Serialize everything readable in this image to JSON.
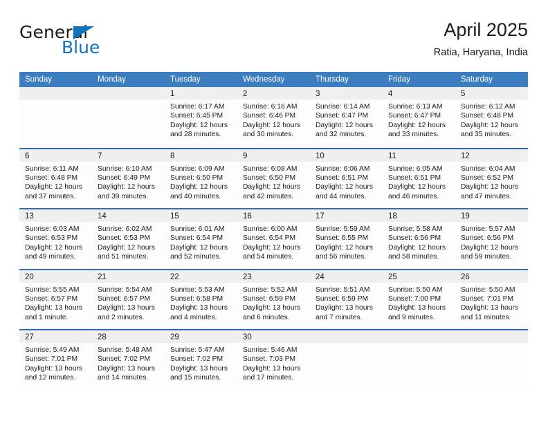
{
  "brand": {
    "name_part1": "General",
    "name_part2": "Blue",
    "triangle_color": "#1273bd"
  },
  "header": {
    "title": "April 2025",
    "subtitle": "Ratia, Haryana, India"
  },
  "calendar": {
    "header_bg": "#3b7dbf",
    "row_divider_color": "#2f6fab",
    "day_band_bg": "#efefef",
    "weekdays": [
      "Sunday",
      "Monday",
      "Tuesday",
      "Wednesday",
      "Thursday",
      "Friday",
      "Saturday"
    ],
    "weeks": [
      [
        {
          "day": "",
          "empty": true
        },
        {
          "day": "",
          "empty": true
        },
        {
          "day": "1",
          "sunrise": "Sunrise: 6:17 AM",
          "sunset": "Sunset: 6:45 PM",
          "daylight_line1": "Daylight: 12 hours",
          "daylight_line2": "and 28 minutes."
        },
        {
          "day": "2",
          "sunrise": "Sunrise: 6:16 AM",
          "sunset": "Sunset: 6:46 PM",
          "daylight_line1": "Daylight: 12 hours",
          "daylight_line2": "and 30 minutes."
        },
        {
          "day": "3",
          "sunrise": "Sunrise: 6:14 AM",
          "sunset": "Sunset: 6:47 PM",
          "daylight_line1": "Daylight: 12 hours",
          "daylight_line2": "and 32 minutes."
        },
        {
          "day": "4",
          "sunrise": "Sunrise: 6:13 AM",
          "sunset": "Sunset: 6:47 PM",
          "daylight_line1": "Daylight: 12 hours",
          "daylight_line2": "and 33 minutes."
        },
        {
          "day": "5",
          "sunrise": "Sunrise: 6:12 AM",
          "sunset": "Sunset: 6:48 PM",
          "daylight_line1": "Daylight: 12 hours",
          "daylight_line2": "and 35 minutes."
        }
      ],
      [
        {
          "day": "6",
          "sunrise": "Sunrise: 6:11 AM",
          "sunset": "Sunset: 6:48 PM",
          "daylight_line1": "Daylight: 12 hours",
          "daylight_line2": "and 37 minutes."
        },
        {
          "day": "7",
          "sunrise": "Sunrise: 6:10 AM",
          "sunset": "Sunset: 6:49 PM",
          "daylight_line1": "Daylight: 12 hours",
          "daylight_line2": "and 39 minutes."
        },
        {
          "day": "8",
          "sunrise": "Sunrise: 6:09 AM",
          "sunset": "Sunset: 6:50 PM",
          "daylight_line1": "Daylight: 12 hours",
          "daylight_line2": "and 40 minutes."
        },
        {
          "day": "9",
          "sunrise": "Sunrise: 6:08 AM",
          "sunset": "Sunset: 6:50 PM",
          "daylight_line1": "Daylight: 12 hours",
          "daylight_line2": "and 42 minutes."
        },
        {
          "day": "10",
          "sunrise": "Sunrise: 6:06 AM",
          "sunset": "Sunset: 6:51 PM",
          "daylight_line1": "Daylight: 12 hours",
          "daylight_line2": "and 44 minutes."
        },
        {
          "day": "11",
          "sunrise": "Sunrise: 6:05 AM",
          "sunset": "Sunset: 6:51 PM",
          "daylight_line1": "Daylight: 12 hours",
          "daylight_line2": "and 46 minutes."
        },
        {
          "day": "12",
          "sunrise": "Sunrise: 6:04 AM",
          "sunset": "Sunset: 6:52 PM",
          "daylight_line1": "Daylight: 12 hours",
          "daylight_line2": "and 47 minutes."
        }
      ],
      [
        {
          "day": "13",
          "sunrise": "Sunrise: 6:03 AM",
          "sunset": "Sunset: 6:53 PM",
          "daylight_line1": "Daylight: 12 hours",
          "daylight_line2": "and 49 minutes."
        },
        {
          "day": "14",
          "sunrise": "Sunrise: 6:02 AM",
          "sunset": "Sunset: 6:53 PM",
          "daylight_line1": "Daylight: 12 hours",
          "daylight_line2": "and 51 minutes."
        },
        {
          "day": "15",
          "sunrise": "Sunrise: 6:01 AM",
          "sunset": "Sunset: 6:54 PM",
          "daylight_line1": "Daylight: 12 hours",
          "daylight_line2": "and 52 minutes."
        },
        {
          "day": "16",
          "sunrise": "Sunrise: 6:00 AM",
          "sunset": "Sunset: 6:54 PM",
          "daylight_line1": "Daylight: 12 hours",
          "daylight_line2": "and 54 minutes."
        },
        {
          "day": "17",
          "sunrise": "Sunrise: 5:59 AM",
          "sunset": "Sunset: 6:55 PM",
          "daylight_line1": "Daylight: 12 hours",
          "daylight_line2": "and 56 minutes."
        },
        {
          "day": "18",
          "sunrise": "Sunrise: 5:58 AM",
          "sunset": "Sunset: 6:56 PM",
          "daylight_line1": "Daylight: 12 hours",
          "daylight_line2": "and 58 minutes."
        },
        {
          "day": "19",
          "sunrise": "Sunrise: 5:57 AM",
          "sunset": "Sunset: 6:56 PM",
          "daylight_line1": "Daylight: 12 hours",
          "daylight_line2": "and 59 minutes."
        }
      ],
      [
        {
          "day": "20",
          "sunrise": "Sunrise: 5:55 AM",
          "sunset": "Sunset: 6:57 PM",
          "daylight_line1": "Daylight: 13 hours",
          "daylight_line2": "and 1 minute."
        },
        {
          "day": "21",
          "sunrise": "Sunrise: 5:54 AM",
          "sunset": "Sunset: 6:57 PM",
          "daylight_line1": "Daylight: 13 hours",
          "daylight_line2": "and 2 minutes."
        },
        {
          "day": "22",
          "sunrise": "Sunrise: 5:53 AM",
          "sunset": "Sunset: 6:58 PM",
          "daylight_line1": "Daylight: 13 hours",
          "daylight_line2": "and 4 minutes."
        },
        {
          "day": "23",
          "sunrise": "Sunrise: 5:52 AM",
          "sunset": "Sunset: 6:59 PM",
          "daylight_line1": "Daylight: 13 hours",
          "daylight_line2": "and 6 minutes."
        },
        {
          "day": "24",
          "sunrise": "Sunrise: 5:51 AM",
          "sunset": "Sunset: 6:59 PM",
          "daylight_line1": "Daylight: 13 hours",
          "daylight_line2": "and 7 minutes."
        },
        {
          "day": "25",
          "sunrise": "Sunrise: 5:50 AM",
          "sunset": "Sunset: 7:00 PM",
          "daylight_line1": "Daylight: 13 hours",
          "daylight_line2": "and 9 minutes."
        },
        {
          "day": "26",
          "sunrise": "Sunrise: 5:50 AM",
          "sunset": "Sunset: 7:01 PM",
          "daylight_line1": "Daylight: 13 hours",
          "daylight_line2": "and 11 minutes."
        }
      ],
      [
        {
          "day": "27",
          "sunrise": "Sunrise: 5:49 AM",
          "sunset": "Sunset: 7:01 PM",
          "daylight_line1": "Daylight: 13 hours",
          "daylight_line2": "and 12 minutes."
        },
        {
          "day": "28",
          "sunrise": "Sunrise: 5:48 AM",
          "sunset": "Sunset: 7:02 PM",
          "daylight_line1": "Daylight: 13 hours",
          "daylight_line2": "and 14 minutes."
        },
        {
          "day": "29",
          "sunrise": "Sunrise: 5:47 AM",
          "sunset": "Sunset: 7:02 PM",
          "daylight_line1": "Daylight: 13 hours",
          "daylight_line2": "and 15 minutes."
        },
        {
          "day": "30",
          "sunrise": "Sunrise: 5:46 AM",
          "sunset": "Sunset: 7:03 PM",
          "daylight_line1": "Daylight: 13 hours",
          "daylight_line2": "and 17 minutes."
        },
        {
          "day": "",
          "empty": true
        },
        {
          "day": "",
          "empty": true
        },
        {
          "day": "",
          "empty": true
        }
      ]
    ]
  }
}
